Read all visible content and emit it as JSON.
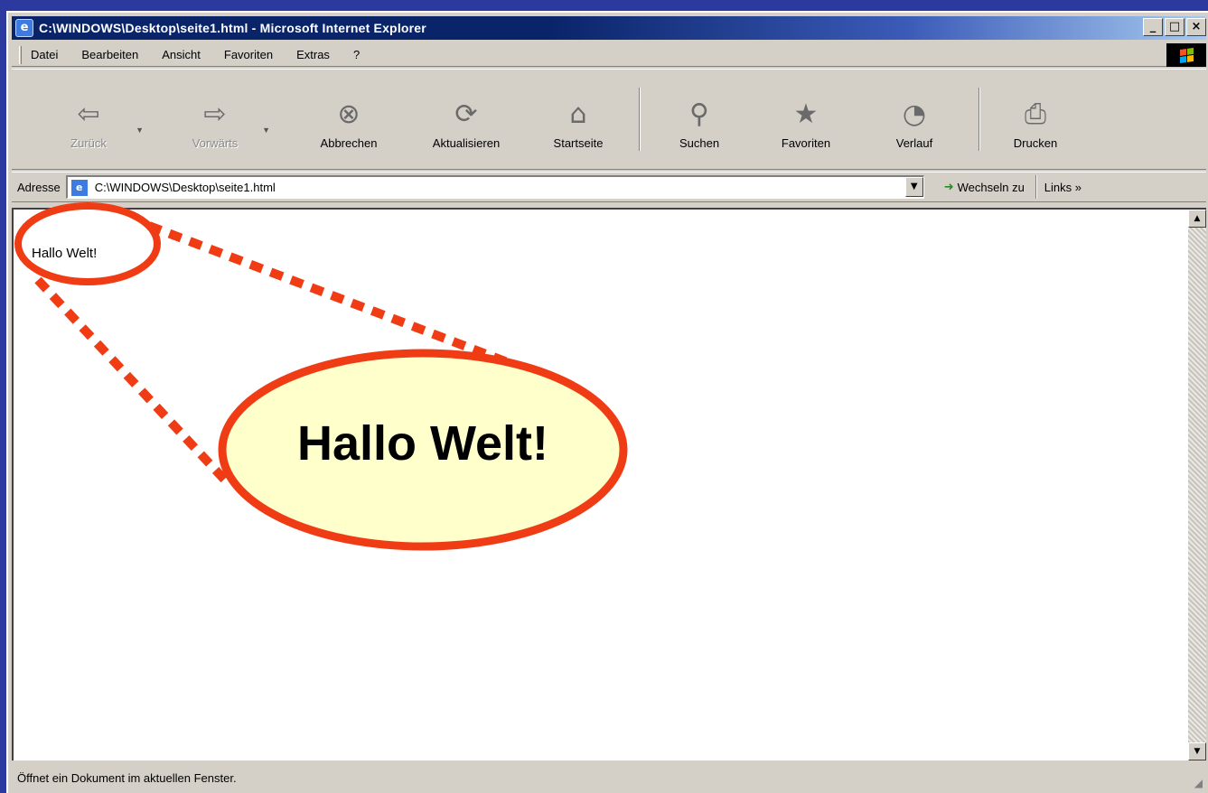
{
  "window": {
    "app_icon": "ie-logo-icon",
    "title": "C:\\WINDOWS\\Desktop\\seite1.html - Microsoft Internet Explorer",
    "controls": {
      "minimize": "_",
      "maximize": "□",
      "close": "×"
    }
  },
  "menu": {
    "items": [
      "Datei",
      "Bearbeiten",
      "Ansicht",
      "Favoriten",
      "Extras",
      "?"
    ]
  },
  "toolbar": {
    "back": {
      "label": "Zurück",
      "icon": "back-arrow-icon",
      "glyph": "⇦"
    },
    "forward": {
      "label": "Vorwärts",
      "icon": "forward-arrow-icon",
      "glyph": "⇨"
    },
    "stop": {
      "label": "Abbrechen",
      "icon": "stop-icon",
      "glyph": "⊗"
    },
    "refresh": {
      "label": "Aktualisieren",
      "icon": "refresh-icon",
      "glyph": "⟳"
    },
    "home": {
      "label": "Startseite",
      "icon": "home-icon",
      "glyph": "⌂"
    },
    "search": {
      "label": "Suchen",
      "icon": "search-icon",
      "glyph": "⚲"
    },
    "favorites": {
      "label": "Favoriten",
      "icon": "favorites-folder-icon",
      "glyph": "★"
    },
    "history": {
      "label": "Verlauf",
      "icon": "history-icon",
      "glyph": "◔"
    },
    "print": {
      "label": "Drucken",
      "icon": "printer-icon",
      "glyph": "⎙"
    }
  },
  "address": {
    "label": "Adresse",
    "value": "C:\\WINDOWS\\Desktop\\seite1.html",
    "go_label": "Wechseln zu",
    "links_label": "Links »"
  },
  "page": {
    "text": "Hallo Welt!"
  },
  "status": {
    "text": "Öffnet ein Dokument im aktuellen Fenster."
  },
  "annotation": {
    "callout_text": "Hallo Welt!",
    "outline_color": "#f03c14",
    "fill_color": "#ffffcc"
  }
}
